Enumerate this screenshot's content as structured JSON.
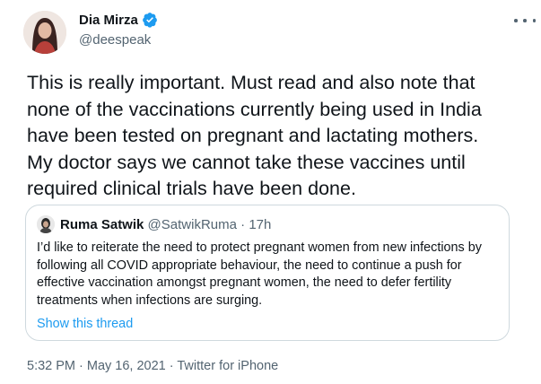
{
  "author": {
    "name": "Dia Mirza",
    "handle": "@deespeak",
    "verified": true
  },
  "tweet": {
    "text": "This is really important. Must read and also note that\nnone of the vaccinations currently being used in India\nhave been tested on pregnant and lactating mothers.\nMy doctor says we cannot take these vaccines until\nrequired clinical trials have been done."
  },
  "quote": {
    "name": "Ruma Satwik",
    "handle": "@SatwikRuma",
    "separator": " · ",
    "time": "17h",
    "text": "I’d like to reiterate the need to protect pregnant women from new infections by\nfollowing all COVID appropriate behaviour, the need to continue a push for\neffective vaccination amongst pregnant women, the need to defer fertility\ntreatments when infections are surging.",
    "thread_link": "Show this thread"
  },
  "meta": {
    "timestamp": "5:32 PM · May 16, 2021 · Twitter for iPhone"
  },
  "colors": {
    "text": "#0f1419",
    "secondary": "#536471",
    "link": "#1d9bf0",
    "border": "#cfd9de"
  },
  "icons": {
    "verified": "verified-badge-icon",
    "more": "more-options-icon"
  }
}
